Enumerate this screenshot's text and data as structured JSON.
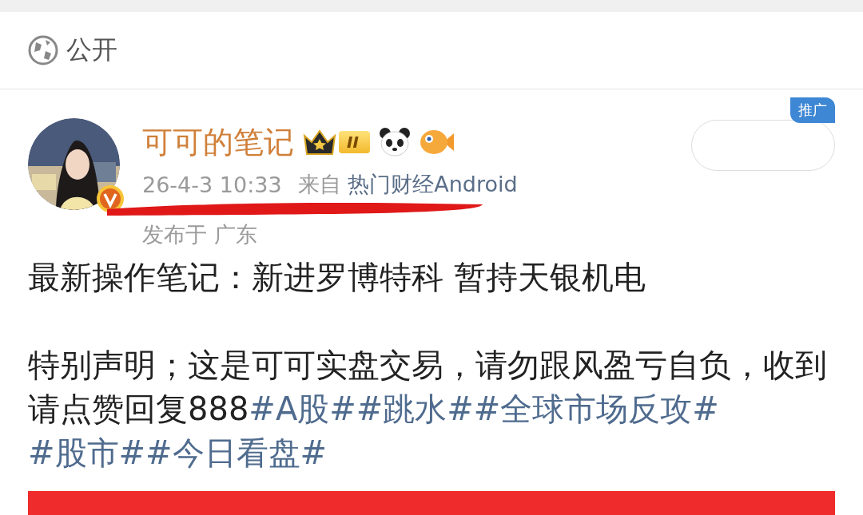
{
  "visibility": {
    "label": "公开"
  },
  "post": {
    "author": "可可的笔记",
    "level_badge": "II",
    "time": "26-4-3 10:33",
    "source_prefix": "来自",
    "source": "热门财经Android",
    "location": "发布于 广东",
    "promo_badge": "推广",
    "paragraphs": [
      {
        "text": "最新操作笔记：新进罗博特科  暂持天银机电"
      },
      {
        "text": "特别声明；这是可可实盘交易，请勿跟风盈亏自负，收到请点赞回复888",
        "hashtags": [
          "#A股#",
          "#跳水#",
          "#全球市场反攻#",
          "#股市#",
          "#今日看盘#"
        ]
      }
    ]
  }
}
